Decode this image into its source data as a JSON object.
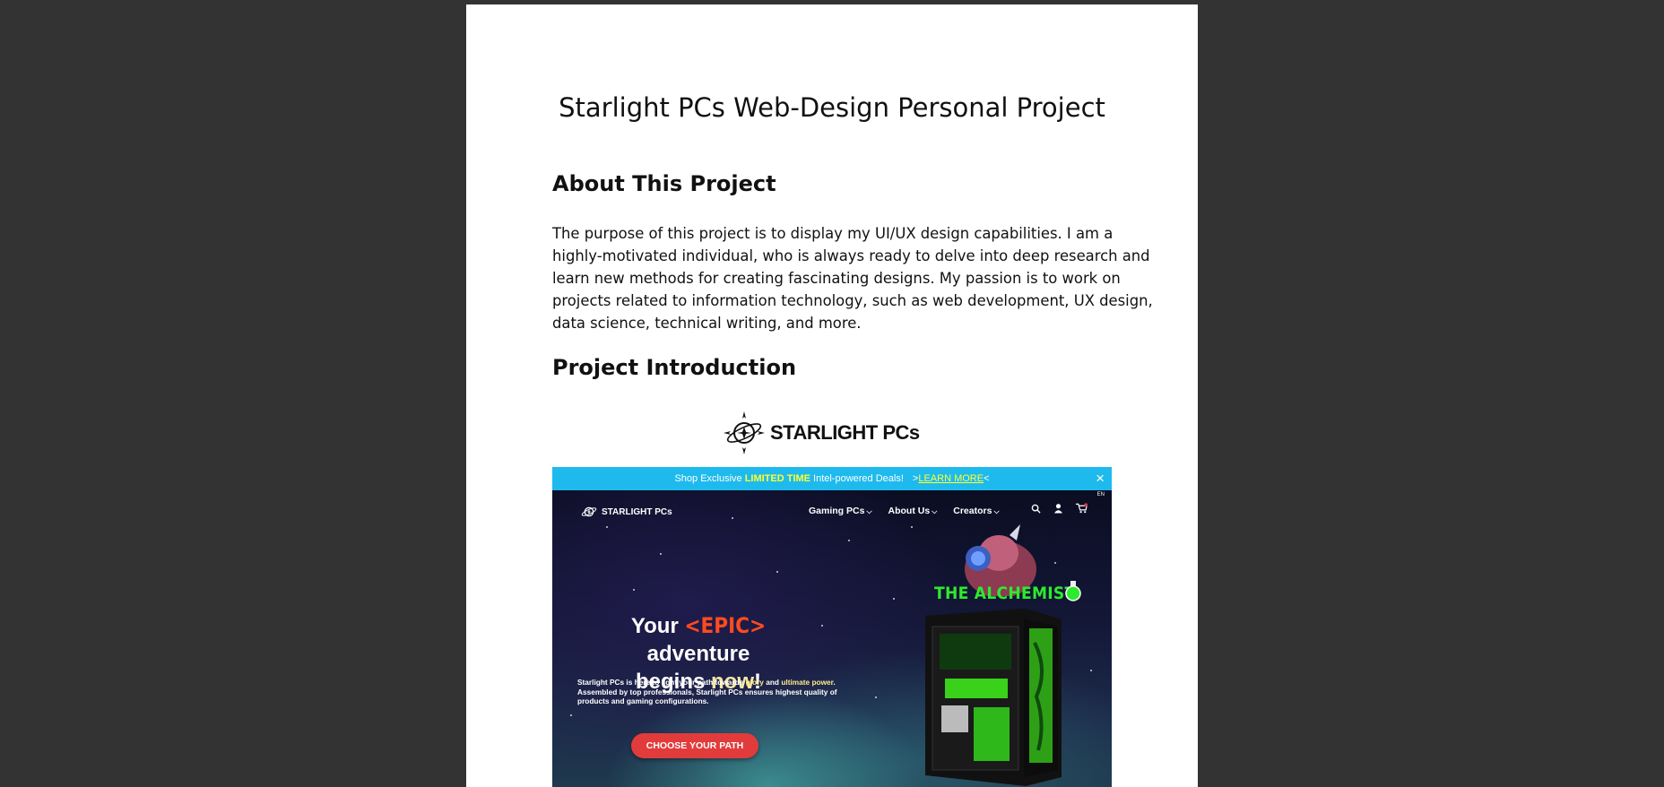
{
  "document": {
    "title": "Starlight PCs Web-Design Personal Project",
    "about_heading": "About This Project",
    "about_lines": [
      "The purpose of this project is to display my UI/UX design capabilities. I am a",
      "highly-motivated individual, who is always ready to delve into deep research and",
      "learn new methods for creating fascinating designs. My passion is to work on",
      "projects related to information technology, such as web development, UX design,",
      "data science, technical writing, and more."
    ],
    "intro_heading": "Project Introduction",
    "logo_text": "STARLIGHT PCs"
  },
  "mockup": {
    "banner": {
      "prefix": "Shop Exclusive",
      "highlight": "LIMITED TIME",
      "suffix": "Intel-powered Deals!",
      "link_open": ">",
      "link_text": "LEARN MORE",
      "link_close": "<",
      "close_icon": "×"
    },
    "nav": {
      "logo_text": "STARLIGHT PCs",
      "items": [
        "Gaming PCs",
        "About Us",
        "Creators"
      ],
      "chevron": "⌵",
      "lang": "EN"
    },
    "hero": {
      "headline_a": "Your",
      "headline_epic": "<EPIC>",
      "headline_b": "adventure",
      "headline_c": "begins",
      "headline_now": "now",
      "headline_bang": "!",
      "sub_a": "Starlight PCs is here to light your path towards",
      "sub_glory": "glory",
      "sub_and": "and",
      "sub_power": "ultimate power",
      "sub_dot": ".",
      "sub_line2": "Assembled by top professionals, Starlight PCs ensures highest quality of",
      "sub_line3": "products and gaming configurations.",
      "cta": "CHOOSE YOUR PATH",
      "product_title": "THE ALCHEMIST"
    }
  },
  "colors": {
    "banner": "#1fbaed",
    "accent_yellow": "#ffff33",
    "epic": "#ff4b1f",
    "cta": "#e23b3b",
    "alchemist_green": "#2eea2e",
    "viewer_bg": "#333333"
  }
}
